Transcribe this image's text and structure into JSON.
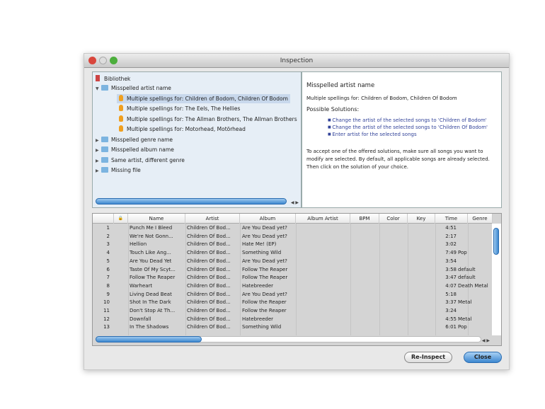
{
  "window": {
    "title": "Inspection"
  },
  "tree": {
    "root": "Bibliothek",
    "groups": [
      {
        "label": "Misspelled artist name",
        "expanded": true,
        "children": [
          "Multiple spellings for: Children of Bodom, Children Of Bodom",
          "Multiple spellings for: The Eels, The Hellies",
          "Multiple spellings for: The Allman Brothers, The Allman Brothers",
          "Multiple spellings for: Motorhead, Motörhead"
        ]
      },
      {
        "label": "Misspelled genre name",
        "expanded": false
      },
      {
        "label": "Misspelled album name",
        "expanded": false
      },
      {
        "label": "Same artist, different genre",
        "expanded": false
      },
      {
        "label": "Missing file",
        "expanded": false
      }
    ]
  },
  "info": {
    "title": "Misspelled artist name",
    "subtitle": "Multiple spellings for: Children of Bodom, Children Of Bodom",
    "solutions_label": "Possible Solutions:",
    "solutions": [
      "Change the artist of the selected songs to 'Children of Bodom'",
      "Change the artist of the selected songs to 'Children Of Bodom'",
      "Enter artist for the selected songs"
    ],
    "note": "To accept one of the offered solutions, make sure all songs you want to modify are selected. By default, all applicable songs are already selected. Then click on the solution of your choice."
  },
  "table": {
    "columns": [
      "",
      "",
      "Name",
      "Artist",
      "Album",
      "Album Artist",
      "BPM",
      "Color",
      "Key",
      "Time",
      "Genre"
    ],
    "rows": [
      [
        "1",
        "Punch Me I Bleed",
        "Children Of Bod...",
        "Are You Dead yet?",
        "4:51",
        ""
      ],
      [
        "2",
        "We're Not Gonn...",
        "Children Of Bod...",
        "Are You Dead yet?",
        "2:17",
        ""
      ],
      [
        "3",
        "Hellion",
        "Children Of Bod...",
        "Hate Me! (EP)",
        "3:02",
        ""
      ],
      [
        "4",
        "Touch Like Ang...",
        "Children Of Bod...",
        "Something Wild",
        "7:49",
        "Pop"
      ],
      [
        "5",
        "Are You Dead Yet",
        "Children Of Bod...",
        "Are You Dead yet?",
        "3:54",
        ""
      ],
      [
        "6",
        "Taste Of My Scyt...",
        "Children Of Bod...",
        "Follow The Reaper",
        "3:58",
        "default"
      ],
      [
        "7",
        "Follow The Reaper",
        "Children Of Bod...",
        "Follow The Reaper",
        "3:47",
        "default"
      ],
      [
        "8",
        "Warheart",
        "Children Of Bod...",
        "Hatebreeder",
        "4:07",
        "Death Metal"
      ],
      [
        "9",
        "Living Dead Beat",
        "Children Of Bod...",
        "Are You Dead yet?",
        "5:18",
        ""
      ],
      [
        "10",
        "Shot In The Dark",
        "Children Of Bod...",
        "Follow the Reaper",
        "3:37",
        "Metal"
      ],
      [
        "11",
        "Don't Stop At Th...",
        "Children Of Bod...",
        "Follow the Reaper",
        "3:24",
        ""
      ],
      [
        "12",
        "Downfall",
        "Children Of Bod...",
        "Hatebreeder",
        "4:55",
        "Metal"
      ],
      [
        "13",
        "In The Shadows",
        "Children Of Bod...",
        "Something Wild",
        "6:01",
        "Pop"
      ]
    ]
  },
  "buttons": {
    "reinspect": "Re-Inspect",
    "close": "Close"
  },
  "colors": {
    "accent": "#3d88d0",
    "link": "#33449a"
  }
}
